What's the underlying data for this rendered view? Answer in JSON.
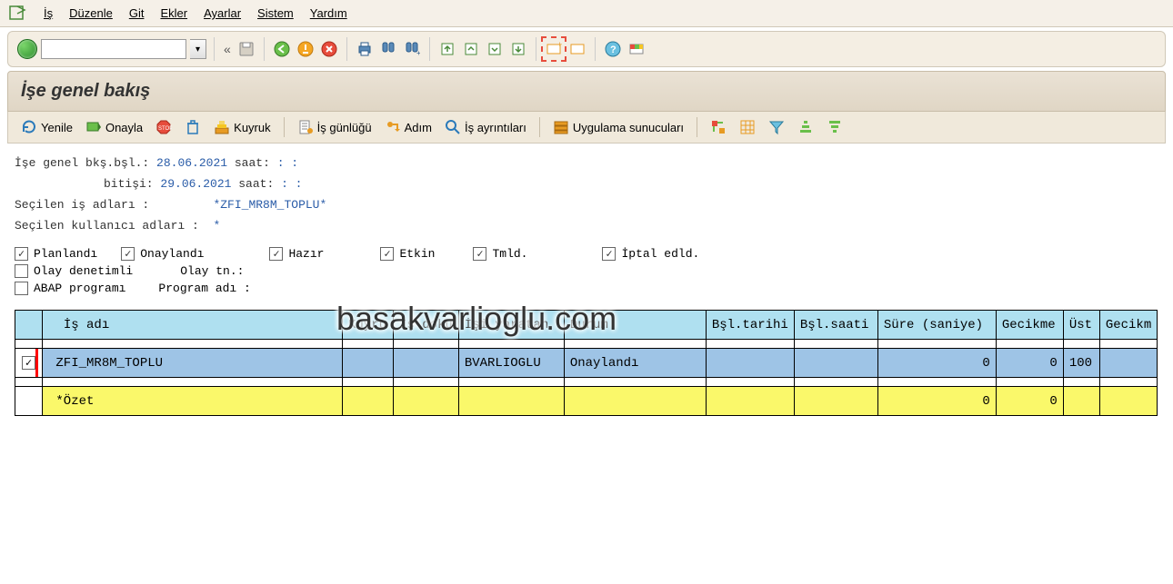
{
  "menu": {
    "items": [
      "İş",
      "Düzenle",
      "Git",
      "Ekler",
      "Ayarlar",
      "Sistem",
      "Yardım"
    ]
  },
  "title": "İşe genel bakış",
  "app_toolbar": {
    "refresh": "Yenile",
    "approve": "Onayla",
    "queue": "Kuyruk",
    "joblog": "İş günlüğü",
    "step": "Adım",
    "details": "İş ayrıntıları",
    "servers": "Uygulama sunucuları"
  },
  "info": {
    "line1_lbl": "İşe genel bkş.bşl.:",
    "line1_date": "28.06.2021",
    "line1_time_lbl": "saat:",
    "line1_time": "  :  :",
    "line2_lbl": "bitişi:",
    "line2_date": "29.06.2021",
    "line2_time_lbl": "saat:",
    "line2_time": "  :  :",
    "line3_lbl": "Seçilen iş adları :",
    "line3_val": "*ZFI_MR8M_TOPLU*",
    "line4_lbl": "Seçilen kullanıcı adları :",
    "line4_val": "*"
  },
  "filters": {
    "planned": {
      "label": "Planlandı",
      "checked": true
    },
    "approved": {
      "label": "Onaylandı",
      "checked": true
    },
    "ready": {
      "label": "Hazır",
      "checked": true
    },
    "active": {
      "label": "Etkin",
      "checked": true
    },
    "completed": {
      "label": "Tmld.",
      "checked": true
    },
    "cancelled": {
      "label": "İptal edld.",
      "checked": true
    },
    "event": {
      "label": "Olay denetimli",
      "checked": false
    },
    "event_tn_lbl": "Olay tn.:",
    "abap": {
      "label": "ABAP programı",
      "checked": false
    },
    "abap_lbl": "Program adı :"
  },
  "table": {
    "cols": [
      "İş adı",
      "Kuyru",
      "İş dokü",
      "İşi yaratan",
      "Durum",
      "Bşl.tarihi",
      "Bşl.saati",
      "Süre (saniye)",
      "Gecikme",
      "Üst",
      "Gecikm"
    ],
    "row": {
      "sel": true,
      "name": "ZFI_MR8M_TOPLU",
      "queue": "",
      "doc": "",
      "creator": "BVARLIOGLU",
      "status": "Onaylandı",
      "start_date": "",
      "start_time": "",
      "duration": "0",
      "delay": "0",
      "parent": "100",
      "delay2": ""
    },
    "summary": {
      "name": "*Özet",
      "duration": "0",
      "delay": "0"
    }
  },
  "watermark": "basakvarlioglu.com"
}
